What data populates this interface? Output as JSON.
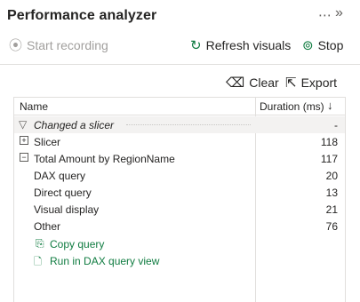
{
  "panel": {
    "title": "Performance analyzer"
  },
  "toolbar": {
    "start_label": "Start recording",
    "refresh_label": "Refresh visuals",
    "stop_label": "Stop",
    "clear_label": "Clear",
    "export_label": "Export"
  },
  "table": {
    "columns": [
      "Name",
      "Duration (ms)"
    ],
    "rows": [
      {
        "name": "Changed a slicer",
        "duration": "-"
      },
      {
        "name": "Slicer",
        "duration": "118"
      },
      {
        "name": "Total Amount by RegionName",
        "duration": "117"
      },
      {
        "name": "DAX query",
        "duration": "20"
      },
      {
        "name": "Direct query",
        "duration": "13"
      },
      {
        "name": "Visual display",
        "duration": "21"
      },
      {
        "name": "Other",
        "duration": "76"
      }
    ],
    "links": {
      "copy_query": "Copy query",
      "run_dax": "Run in DAX query view"
    }
  },
  "colors": {
    "accent": "#107c41",
    "disabled": "#a19f9d",
    "border": "#e1dfdd"
  },
  "icons": {
    "more": "more-options-icon",
    "collapse": "collapse-pane-icon",
    "start": "record-icon",
    "refresh": "refresh-icon",
    "stop": "stop-icon",
    "clear": "eraser-icon",
    "export": "export-icon",
    "sort": "sort-descending-icon",
    "filter": "filter-icon",
    "copy": "copy-icon",
    "dax": "dax-query-icon"
  }
}
